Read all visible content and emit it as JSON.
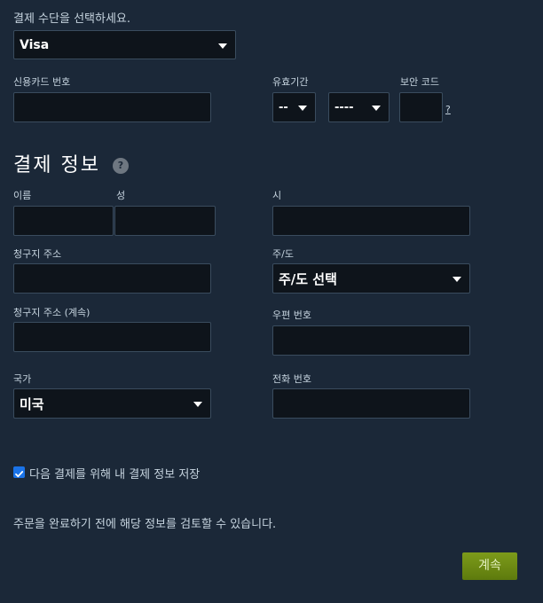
{
  "payment_method": {
    "prompt": "결제 수단을 선택하세요.",
    "selected": "Visa"
  },
  "card": {
    "number_label": "신용카드 번호",
    "expiry_label": "유효기간",
    "expiry_month_selected": "--",
    "expiry_year_selected": "----",
    "security_code_label": "보안 코드",
    "security_help_link": "?"
  },
  "billing": {
    "section_title": "결제 정보",
    "help_icon": "?",
    "first_name_label": "이름",
    "last_name_label": "성",
    "city_label": "시",
    "address_label": "청구지 주소",
    "state_label": "주/도",
    "state_selected": "주/도 선택",
    "address2_label": "청구지 주소 (계속)",
    "postal_label": "우편 번호",
    "country_label": "국가",
    "country_selected": "미국",
    "phone_label": "전화 번호"
  },
  "save_info": {
    "checked": true,
    "label": "다음 결제를 위해 내 결제 정보 저장"
  },
  "review_note": "주문을 완료하기 전에 해당 정보를 검토할 수 있습니다.",
  "continue_button": "계속",
  "colors": {
    "background": "#1b2838",
    "field": "#0e141b",
    "field_border": "#3a4c5e",
    "continue_button": "#6f8c15",
    "checkbox": "#1a73e8"
  },
  "icons": {
    "dropdown": "caret-down-icon",
    "help": "question-icon",
    "checkbox": "checkmark-icon"
  }
}
